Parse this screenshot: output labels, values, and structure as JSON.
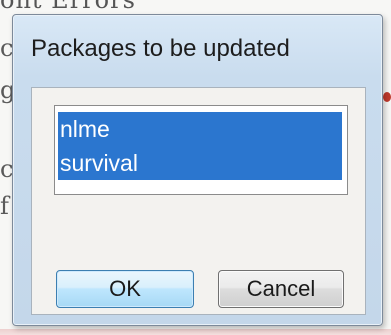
{
  "background": {
    "top_text": "ont Errors",
    "side_letters": [
      "c",
      "g",
      "c",
      "f"
    ]
  },
  "dialog": {
    "title": "Packages to be updated",
    "packages": [
      "nlme",
      "survival"
    ],
    "ok_label": "OK",
    "cancel_label": "Cancel"
  },
  "colors": {
    "selection": "#2b76cf",
    "dialog_frame": "#c9dcee"
  }
}
